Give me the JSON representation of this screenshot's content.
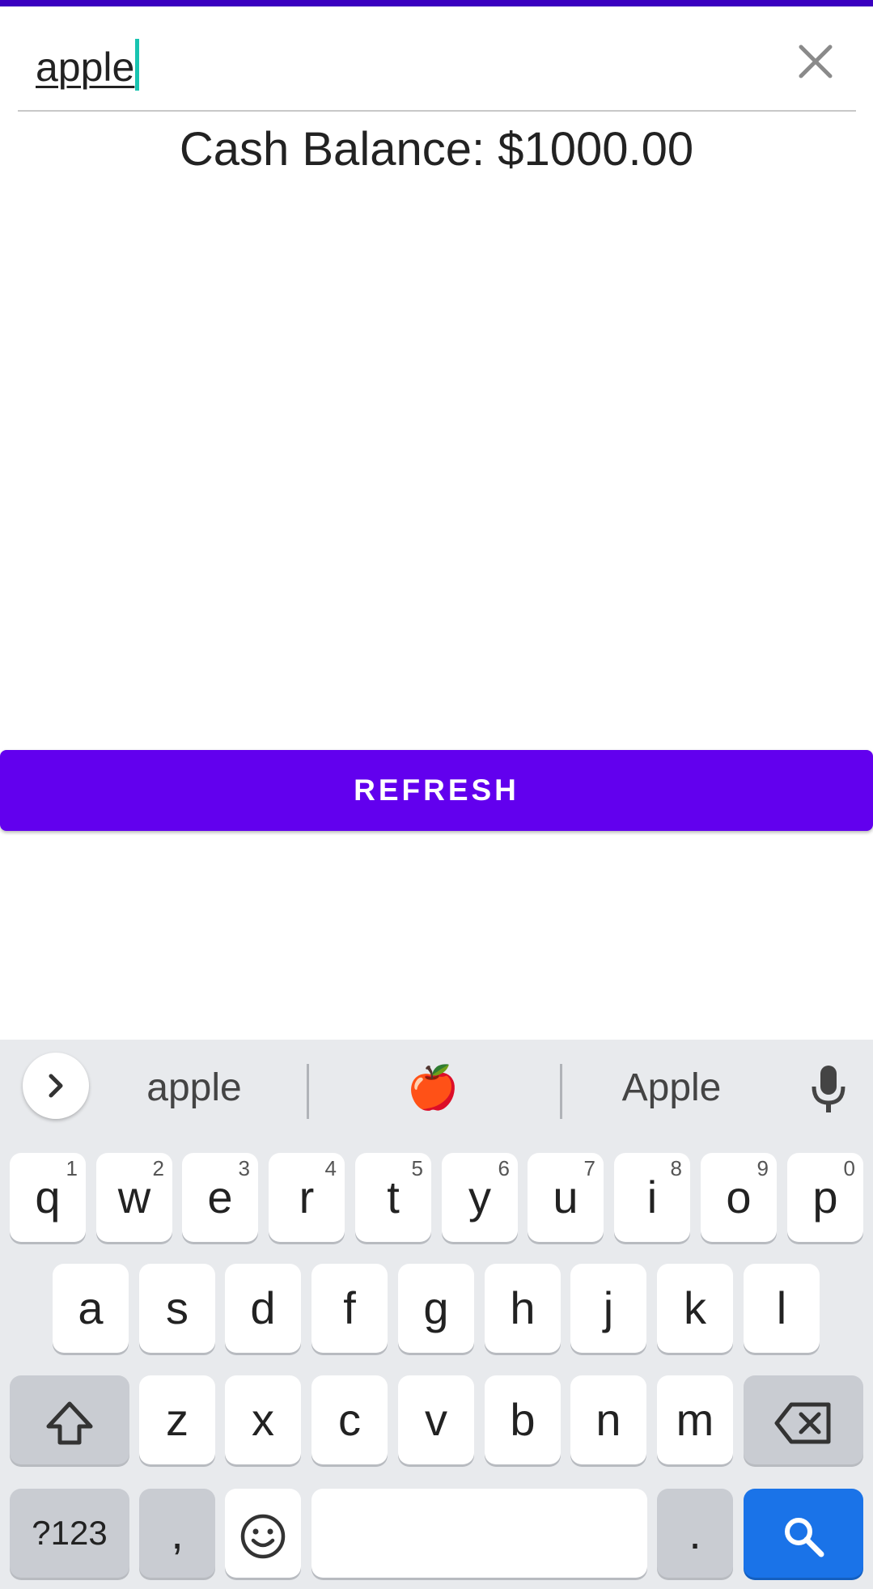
{
  "search": {
    "value": "apple",
    "close_icon": "close-icon"
  },
  "balance_text": "Cash Balance: $1000.00",
  "refresh_label": "REFRESH",
  "keyboard": {
    "suggestions": [
      "apple",
      "🍎",
      "Apple"
    ],
    "row1": [
      {
        "k": "q",
        "h": "1"
      },
      {
        "k": "w",
        "h": "2"
      },
      {
        "k": "e",
        "h": "3"
      },
      {
        "k": "r",
        "h": "4"
      },
      {
        "k": "t",
        "h": "5"
      },
      {
        "k": "y",
        "h": "6"
      },
      {
        "k": "u",
        "h": "7"
      },
      {
        "k": "i",
        "h": "8"
      },
      {
        "k": "o",
        "h": "9"
      },
      {
        "k": "p",
        "h": "0"
      }
    ],
    "row2": [
      "a",
      "s",
      "d",
      "f",
      "g",
      "h",
      "j",
      "k",
      "l"
    ],
    "row3": [
      "z",
      "x",
      "c",
      "v",
      "b",
      "n",
      "m"
    ],
    "symbols_label": "?123",
    "comma_label": ",",
    "period_label": "."
  },
  "colors": {
    "accent": "#6200ee",
    "status_strip": "#3a00c0",
    "caret": "#18c4b0",
    "search_key": "#1a73e8"
  }
}
